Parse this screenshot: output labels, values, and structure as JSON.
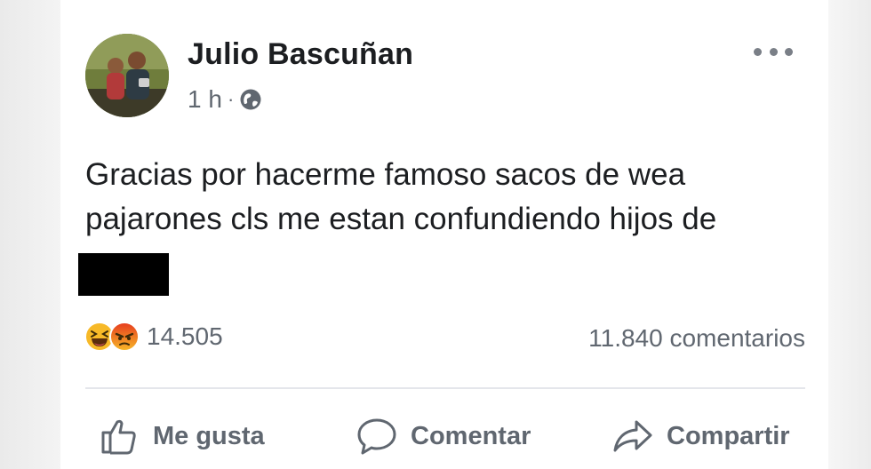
{
  "post": {
    "author": "Julio Bascuñan",
    "time": "1 h",
    "separator": "·",
    "privacy_icon": "globe-icon",
    "text_line1": "Gracias por hacerme famoso sacos de wea",
    "text_line2": "pajarones cls me estan confundiendo hijos de",
    "more_icon": "more-options-icon"
  },
  "stats": {
    "reaction_icons": [
      "laugh-reaction-icon",
      "angry-reaction-icon"
    ],
    "reactions_count": "14.505",
    "comments_count": "11.840 comentarios"
  },
  "actions": {
    "like_label": "Me gusta",
    "comment_label": "Comentar",
    "share_label": "Compartir"
  },
  "colors": {
    "text": "#1c1e21",
    "secondary": "#606770",
    "divider": "#e4e6eb",
    "laugh": "#f7b928",
    "angry": "#e9710f"
  }
}
